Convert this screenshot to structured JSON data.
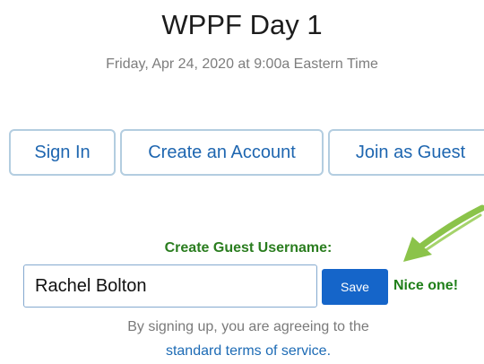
{
  "event": {
    "title": "WPPF Day 1",
    "datetime": "Friday, Apr 24, 2020 at 9:00a Eastern Time"
  },
  "options": {
    "sign_in": "Sign In",
    "create_account": "Create an Account",
    "join_guest": "Join as Guest"
  },
  "guest": {
    "label": "Create Guest Username:",
    "username_value": "Rachel Bolton",
    "save_label": "Save",
    "annotation": "Nice one!"
  },
  "terms": {
    "text": "By signing up, you are agreeing to the",
    "link_text": "standard terms of service."
  },
  "colors": {
    "link_blue": "#1e66b0",
    "save_blue": "#1565c9",
    "guest_green": "#2a7d1f",
    "arrow_green": "#8bc34a"
  },
  "icons": {
    "annotation_arrow": "arrow-icon"
  }
}
